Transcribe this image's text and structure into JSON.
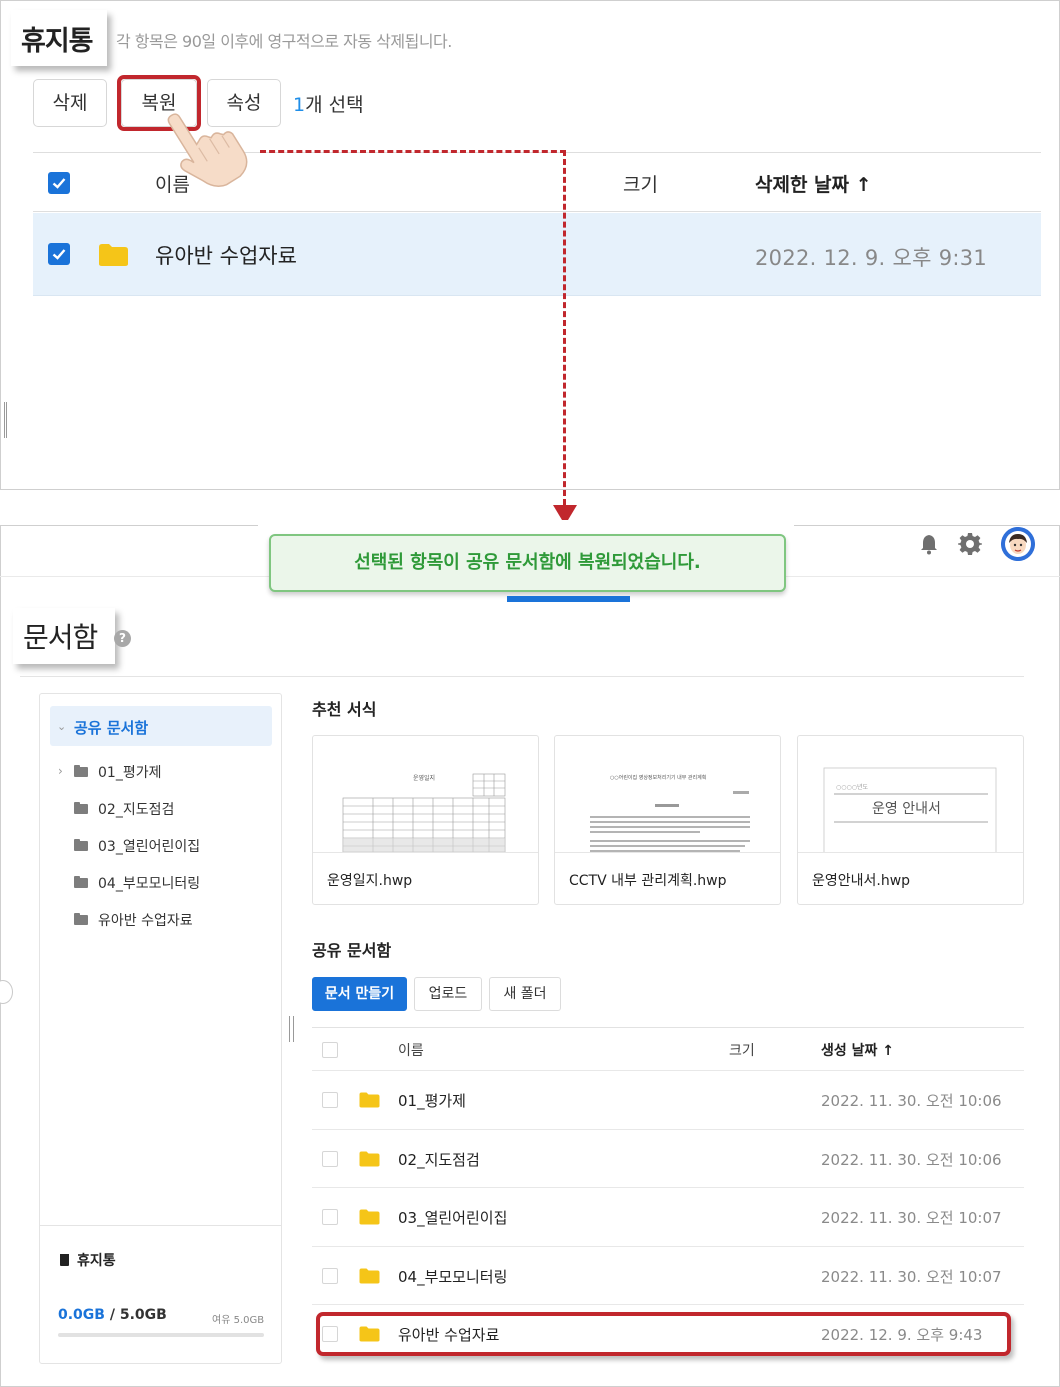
{
  "trash": {
    "title": "휴지통",
    "note": "각 항목은 90일 이후에 영구적으로 자동 삭제됩니다.",
    "toolbar": {
      "delete_label": "삭제",
      "restore_label": "복원",
      "properties_label": "속성",
      "selected_count": "1",
      "selected_suffix": "개 선택"
    },
    "table": {
      "columns": [
        "이름",
        "크기",
        "삭제한 날짜"
      ],
      "sort_arrow": "↑",
      "rows": [
        {
          "name": "유아반 수업자료",
          "size": "",
          "deleted_date": "2022. 12. 9. 오후 9:31",
          "checked": true
        }
      ]
    }
  },
  "toast": {
    "message": "선택된 항목이 공유 문서함에 복원되었습니다."
  },
  "header_icons": [
    "bell-icon",
    "gear-icon",
    "avatar"
  ],
  "docs": {
    "title": "문서함",
    "help": "?",
    "sidebar": {
      "active": "공유 문서함",
      "items": [
        "01_평가제",
        "02_지도점검",
        "03_열린어린이집",
        "04_부모모니터링",
        "유아반 수업자료"
      ],
      "trash_label": "휴지통",
      "storage_used": "0.0GB",
      "storage_total": " / 5.0GB",
      "storage_free": "여유 5.0GB"
    },
    "templates": {
      "section_title": "추천 서식",
      "cards": [
        {
          "name": "운영일지.hwp",
          "thumb_title": "운영일지"
        },
        {
          "name": "CCTV 내부 관리계획.hwp",
          "thumb_title": "○○어린이집 영상정보처리기기 내부 관리계획"
        },
        {
          "name": "운영안내서.hwp",
          "thumb_title": "운영 안내서",
          "thumb_year": "○○○○년도"
        }
      ]
    },
    "shared": {
      "section_title": "공유 문서함",
      "buttons": {
        "create": "문서 만들기",
        "upload": "업로드",
        "new_folder": "새 폴더"
      },
      "columns": [
        "이름",
        "크기",
        "생성 날짜"
      ],
      "sort_arrow": "↑",
      "rows": [
        {
          "name": "01_평가제",
          "size": "",
          "created": "2022. 11. 30. 오전 10:06"
        },
        {
          "name": "02_지도점검",
          "size": "",
          "created": "2022. 11. 30. 오전 10:06"
        },
        {
          "name": "03_열린어린이집",
          "size": "",
          "created": "2022. 11. 30. 오전 10:07"
        },
        {
          "name": "04_부모모니터링",
          "size": "",
          "created": "2022. 11. 30. 오전 10:07"
        },
        {
          "name": "유아반 수업자료",
          "size": "",
          "created": "2022. 12. 9. 오후 9:43"
        }
      ]
    }
  },
  "colors": {
    "accent_blue": "#1a73d9",
    "annotation_red": "#c1272d",
    "toast_green": "#2f9a39",
    "folder_yellow": "#f5c518"
  }
}
